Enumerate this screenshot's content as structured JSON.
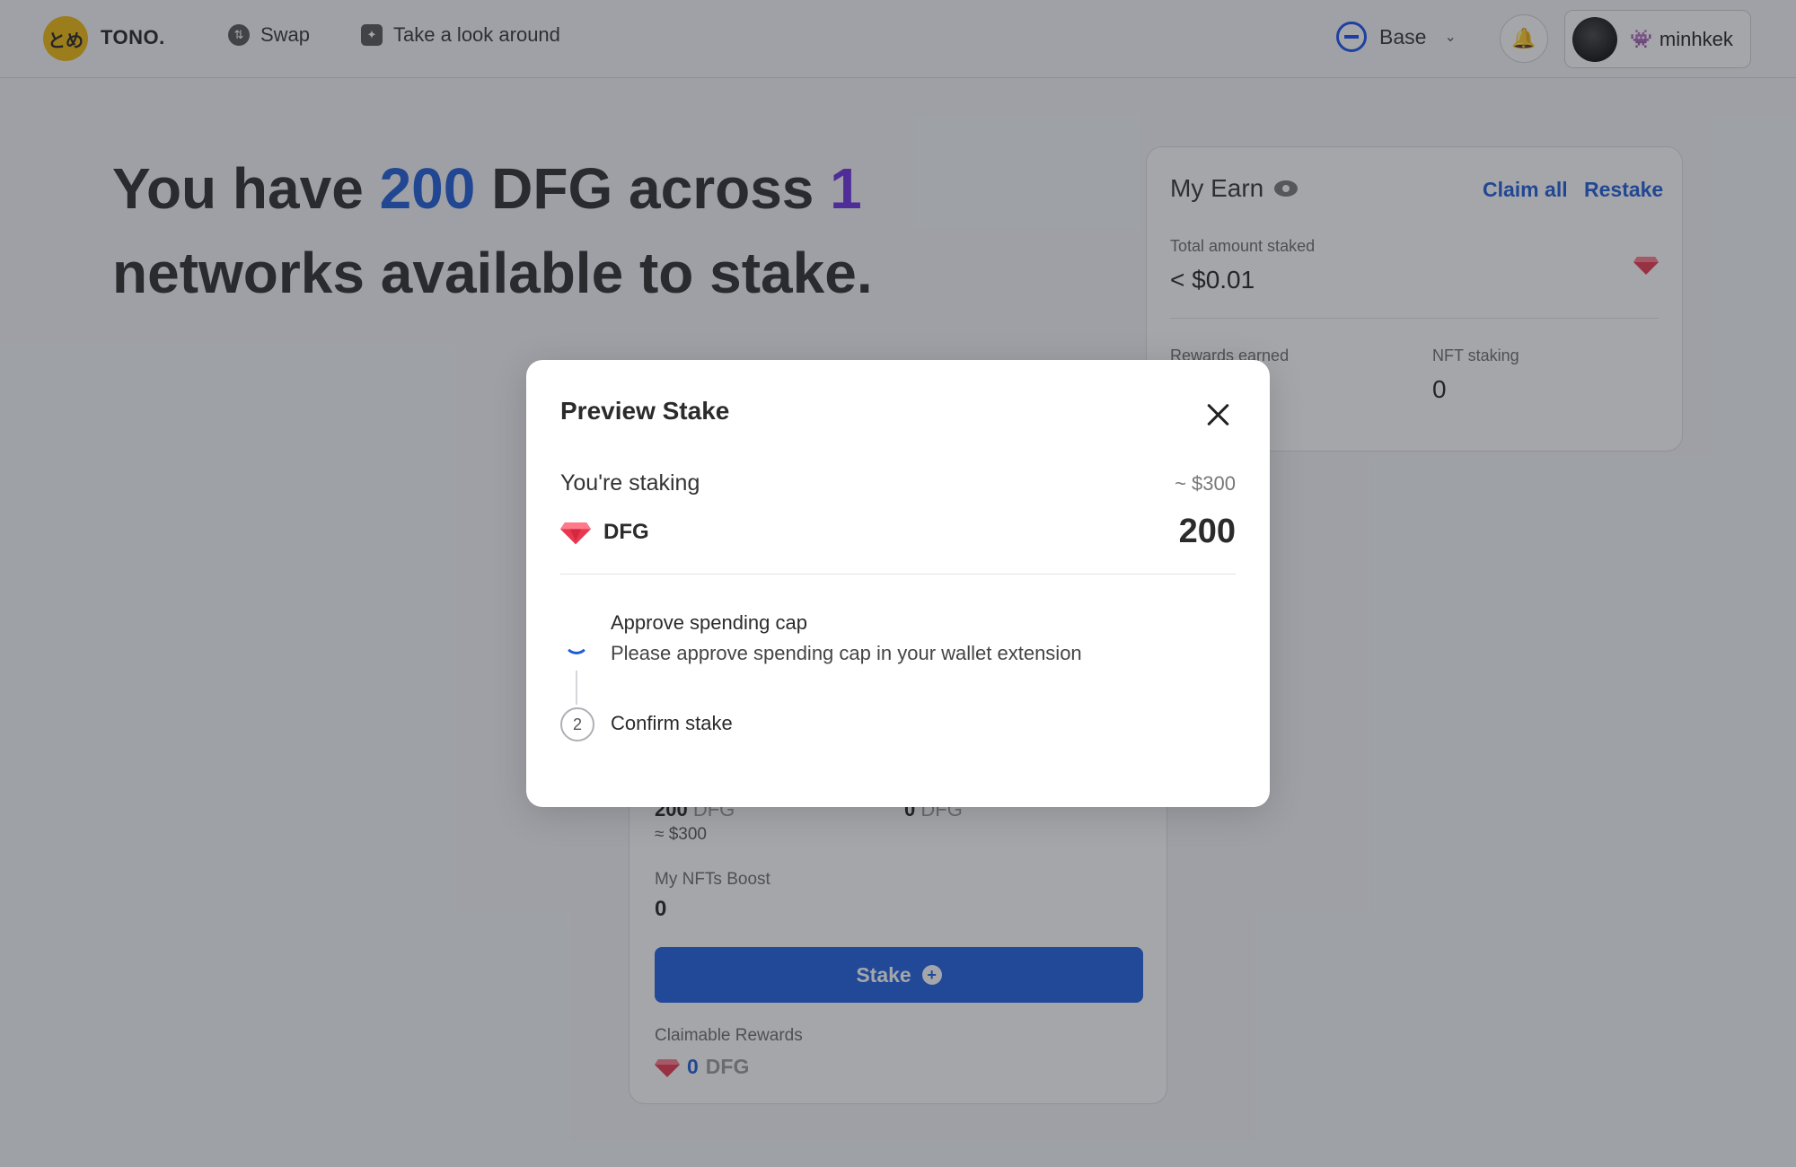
{
  "header": {
    "logo_text": "とめ",
    "brand": "TONO.",
    "nav": [
      {
        "label": "Swap",
        "icon": "swap-icon"
      },
      {
        "label": "Take a look around",
        "icon": "explore-icon"
      }
    ],
    "network": {
      "label": "Base",
      "icon": "base-network-icon"
    },
    "user": {
      "name": "minhkek",
      "emoji": "👾"
    }
  },
  "headline": {
    "prefix": "You have ",
    "amount": "200",
    "middle": " DFG across ",
    "count": "1",
    "suffix": " networks available to stake."
  },
  "earn": {
    "title": "My Earn",
    "claim_all": "Claim all",
    "restake": "Restake",
    "total_staked_label": "Total amount staked",
    "total_staked_value": "< $0.01",
    "rewards_label": "Rewards earned",
    "nft_staking_label": "NFT staking",
    "nft_staking_value": "0"
  },
  "stake_card": {
    "balance_amount": "200",
    "balance_unit": "DFG",
    "balance_usd": "≈ $300",
    "staked_amount": "0",
    "staked_unit": "DFG",
    "nfts_boost_label": "My NFTs Boost",
    "nfts_boost_value": "0",
    "stake_button": "Stake",
    "claimable_label": "Claimable Rewards",
    "claimable_amount": "0",
    "claimable_unit": "DFG"
  },
  "modal": {
    "title": "Preview Stake",
    "staking_label": "You're staking",
    "usd_value": "~ $300",
    "token": "DFG",
    "amount": "200",
    "steps": [
      {
        "title": "Approve spending cap",
        "description": "Please approve spending cap in your wallet extension",
        "state": "loading"
      },
      {
        "number": "2",
        "title": "Confirm stake",
        "state": "pending"
      }
    ]
  },
  "colors": {
    "accent": "#1e5cd6",
    "purple": "#6b2fe0",
    "button": "#1d5fde",
    "logo": "#f0b90b"
  }
}
